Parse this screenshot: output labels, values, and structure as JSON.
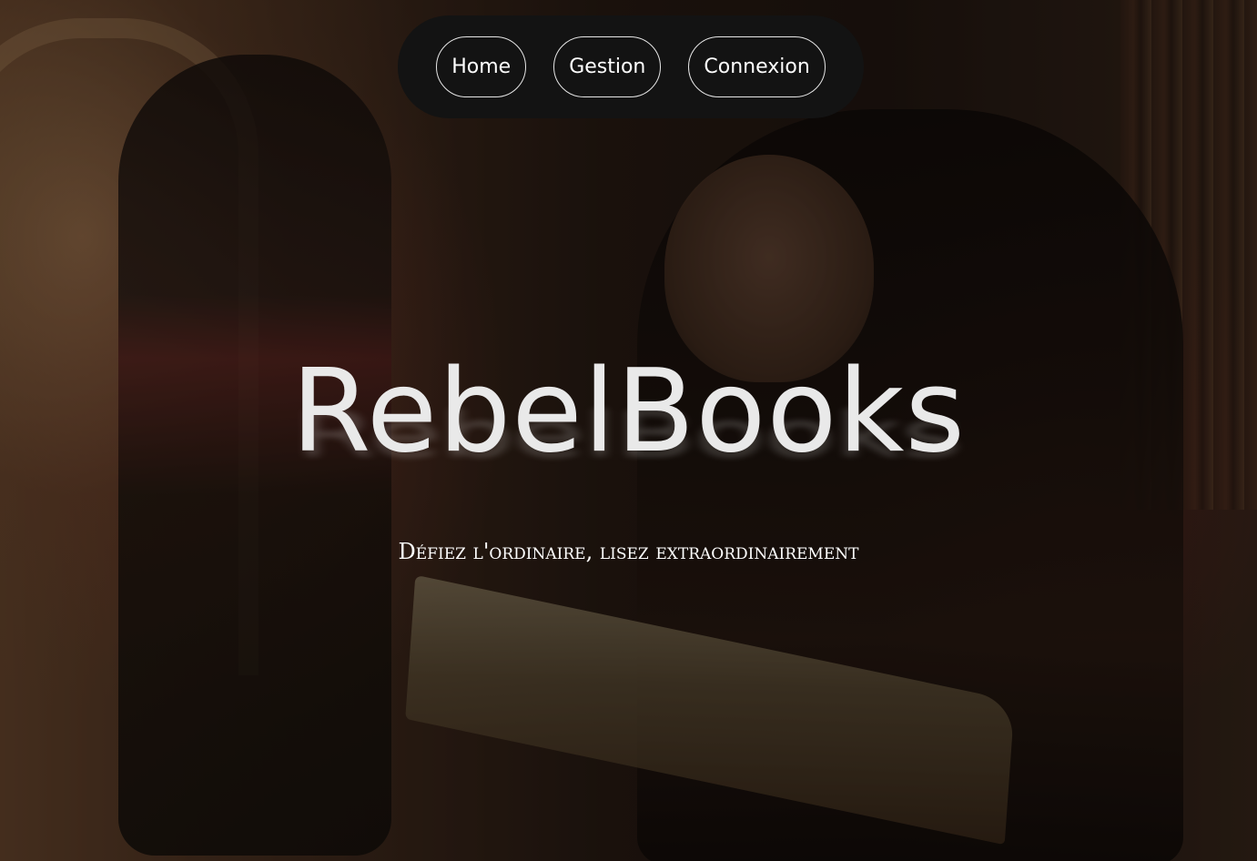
{
  "nav": {
    "items": [
      {
        "label": "Home"
      },
      {
        "label": "Gestion"
      },
      {
        "label": "Connexion"
      }
    ]
  },
  "hero": {
    "title": "RebelBooks",
    "tagline": "Défiez l'ordinaire, lisez extraordinairement",
    "background_image": "library-students-reading"
  },
  "colors": {
    "nav_background": "#131313",
    "nav_border": "#e6e6e6",
    "title_color": "#e9e9e9",
    "tagline_color": "#ffffff"
  }
}
